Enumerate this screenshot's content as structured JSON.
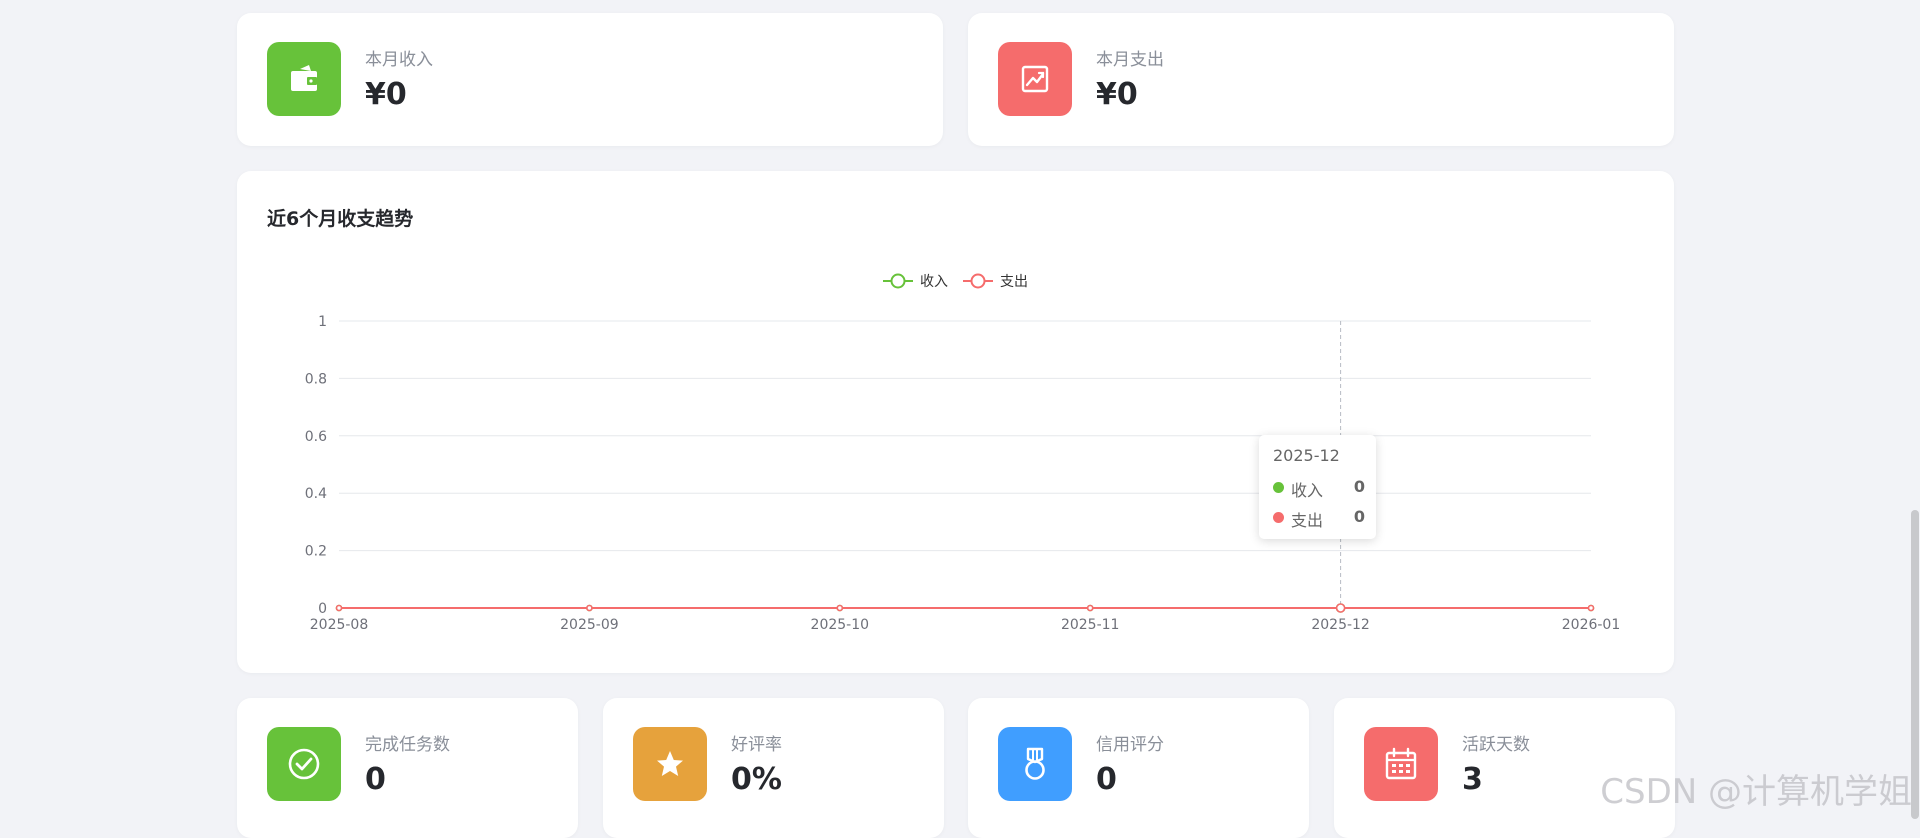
{
  "top_stats": [
    {
      "label": "本月收入",
      "value": "¥0",
      "icon": "wallet-icon",
      "color": "#67c23a"
    },
    {
      "label": "本月支出",
      "value": "¥0",
      "icon": "trend-chart-icon",
      "color": "#f56c6c"
    }
  ],
  "trend_card": {
    "title": "近6个月收支趋势"
  },
  "chart_data": {
    "type": "line",
    "categories": [
      "2025-08",
      "2025-09",
      "2025-10",
      "2025-11",
      "2025-12",
      "2026-01"
    ],
    "series": [
      {
        "name": "收入",
        "values": [
          0,
          0,
          0,
          0,
          0,
          0
        ],
        "color": "#67c23a"
      },
      {
        "name": "支出",
        "values": [
          0,
          0,
          0,
          0,
          0,
          0
        ],
        "color": "#f56c6c"
      }
    ],
    "ylim": [
      0,
      1
    ],
    "yticks": [
      "0",
      "0.2",
      "0.4",
      "0.6",
      "0.8",
      "1"
    ],
    "legend_position": "top-center",
    "grid": true,
    "tooltip": {
      "category": "2025-12",
      "items": [
        {
          "name": "收入",
          "value": "0",
          "color": "#67c23a"
        },
        {
          "name": "支出",
          "value": "0",
          "color": "#f56c6c"
        }
      ]
    }
  },
  "bottom_stats": [
    {
      "label": "完成任务数",
      "value": "0",
      "icon": "check-circle-icon",
      "color": "#67c23a"
    },
    {
      "label": "好评率",
      "value": "0%",
      "icon": "star-icon",
      "color": "#e6a23c"
    },
    {
      "label": "信用评分",
      "value": "0",
      "icon": "medal-icon",
      "color": "#409eff"
    },
    {
      "label": "活跃天数",
      "value": "3",
      "icon": "calendar-icon",
      "color": "#f56c6c"
    }
  ],
  "watermark": "CSDN @计算机学姐"
}
